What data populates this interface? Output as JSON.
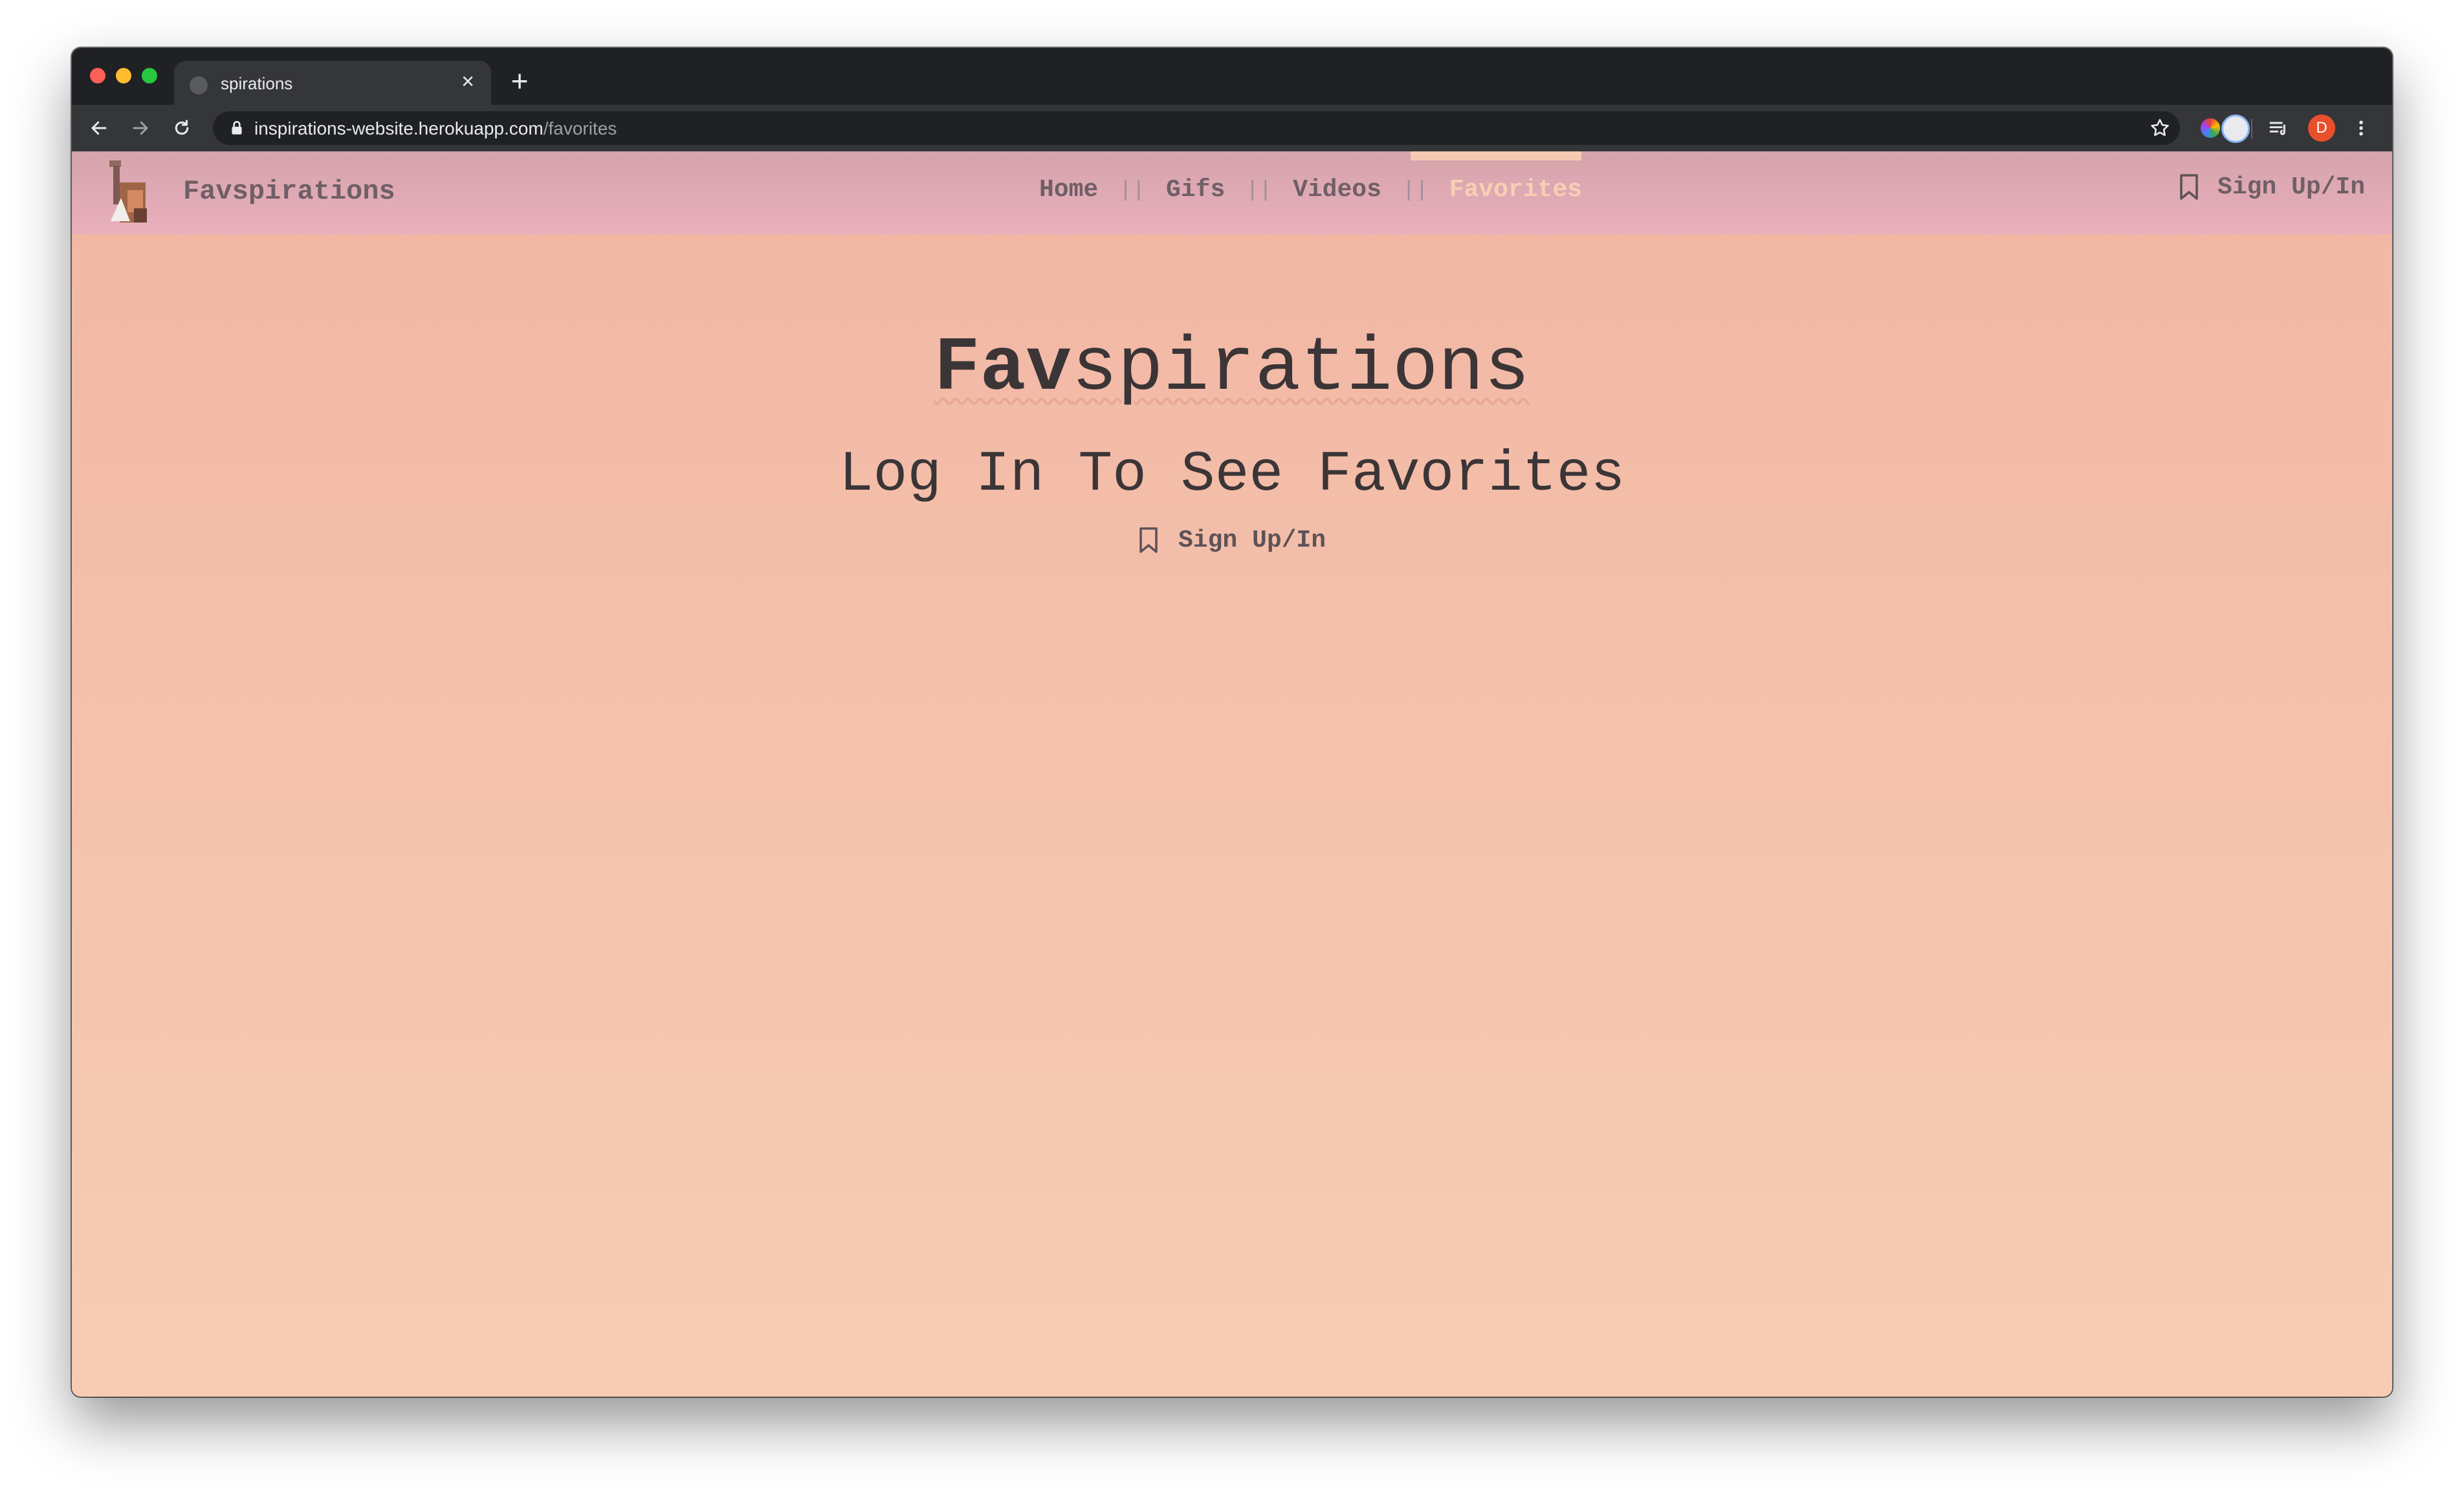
{
  "browser": {
    "tab_title": "spirations",
    "tab_close_glyph": "×",
    "new_tab_glyph": "+",
    "url_host": "inspirations-website.herokuapp.com",
    "url_path": "/favorites",
    "profile_initial": "D",
    "icons": [
      "back-arrow-icon",
      "forward-arrow-icon",
      "reload-icon",
      "lock-icon",
      "star-icon",
      "color-wheel-extension-icon",
      "circle-extension-icon",
      "media-queue-icon",
      "more-vert-icon"
    ],
    "colors": {
      "frame": "#202124",
      "toolbar": "#35363a",
      "profile": "#e8502b"
    }
  },
  "nav": {
    "brand": "Favspirations",
    "links": [
      {
        "label": "Home"
      },
      {
        "label": "Gifs"
      },
      {
        "label": "Videos"
      },
      {
        "label": "Favorites",
        "active": true
      }
    ],
    "separator": "||",
    "signin_label": "Sign Up/In",
    "colors": {
      "text": "#6f5f66",
      "active": "#f7cfb3",
      "bar_top": "#d5a3ab",
      "bar_bottom": "#e9b0bd"
    }
  },
  "main": {
    "title_bold": "Fav",
    "title_rest": "spirations",
    "subtitle": "Log In To See Favorites",
    "signin_label": "Sign Up/In",
    "colors": {
      "background_top": "#f2b7a4",
      "background_bottom": "#f6cdb4",
      "heading": "#3b3537"
    }
  }
}
